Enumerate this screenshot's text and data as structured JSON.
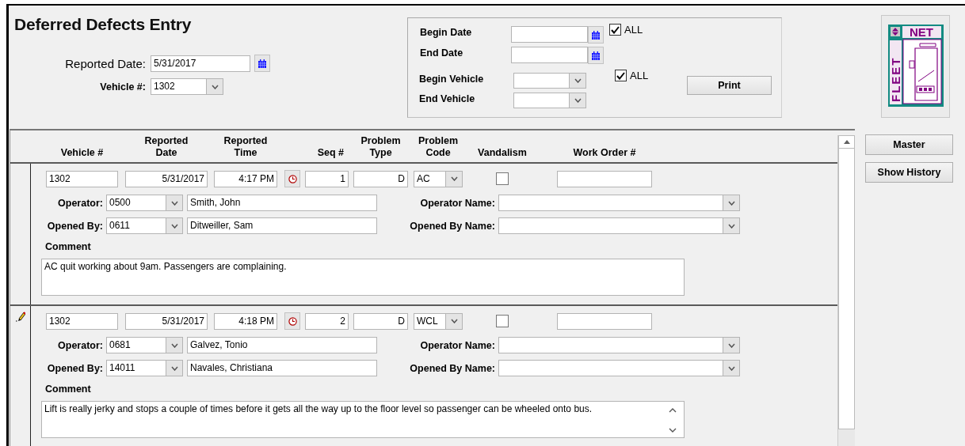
{
  "window": {
    "title": "Deferred Defects Entry"
  },
  "header": {
    "reported_date_label": "Reported Date:",
    "reported_date": "5/31/2017",
    "vehicle_label": "Vehicle #:",
    "vehicle": "1302"
  },
  "filter": {
    "begin_date_label": "Begin Date",
    "end_date_label": "End Date",
    "dates_all": {
      "label": "ALL",
      "checked": true
    },
    "begin_vehicle_label": "Begin Vehicle",
    "end_vehicle_label": "End Vehicle",
    "vehicles_all": {
      "label": "ALL",
      "checked": true
    },
    "print_button": "Print"
  },
  "logo": {
    "top_text": "NET",
    "side_text": "FLEET"
  },
  "table": {
    "columns": [
      "Vehicle #",
      "Reported\nDate",
      "Reported\nTime",
      "Seq #",
      "Problem\nType",
      "Problem\nCode",
      "Vandalism",
      "Work Order #"
    ],
    "records": [
      {
        "editing": false,
        "vehicle": "1302",
        "reported_date": "5/31/2017",
        "reported_time": "4:17 PM",
        "seq": "1",
        "problem_type": "D",
        "problem_code": "AC",
        "vandalism": false,
        "operator_label": "Operator:",
        "operator_code": "0500",
        "operator_full_name": "Smith, John",
        "operator_name_label": "Operator Name:",
        "opened_by_label": "Opened By:",
        "opened_by_code": "0611",
        "opened_by_full_name": "Ditweiller, Sam",
        "opened_by_name_label": "Opened By Name:",
        "comment_label": "Comment",
        "comment": "AC quit working about 9am. Passengers are complaining.",
        "comment_scrollbar": false
      },
      {
        "editing": true,
        "vehicle": "1302",
        "reported_date": "5/31/2017",
        "reported_time": "4:18 PM",
        "seq": "2",
        "problem_type": "D",
        "problem_code": "WCL",
        "vandalism": false,
        "operator_label": "Operator:",
        "operator_code": "0681",
        "operator_full_name": "Galvez, Tonio",
        "operator_name_label": "Operator Name:",
        "opened_by_label": "Opened By:",
        "opened_by_code": "14011",
        "opened_by_full_name": "Navales, Christiana",
        "opened_by_name_label": "Opened By Name:",
        "comment_label": "Comment",
        "comment": "Lift is really jerky and stops a couple of times before it gets all the way up to the floor level so passenger can be wheeled onto bus.",
        "comment_scrollbar": true
      }
    ]
  },
  "side_buttons": [
    "Master",
    "Show History"
  ]
}
